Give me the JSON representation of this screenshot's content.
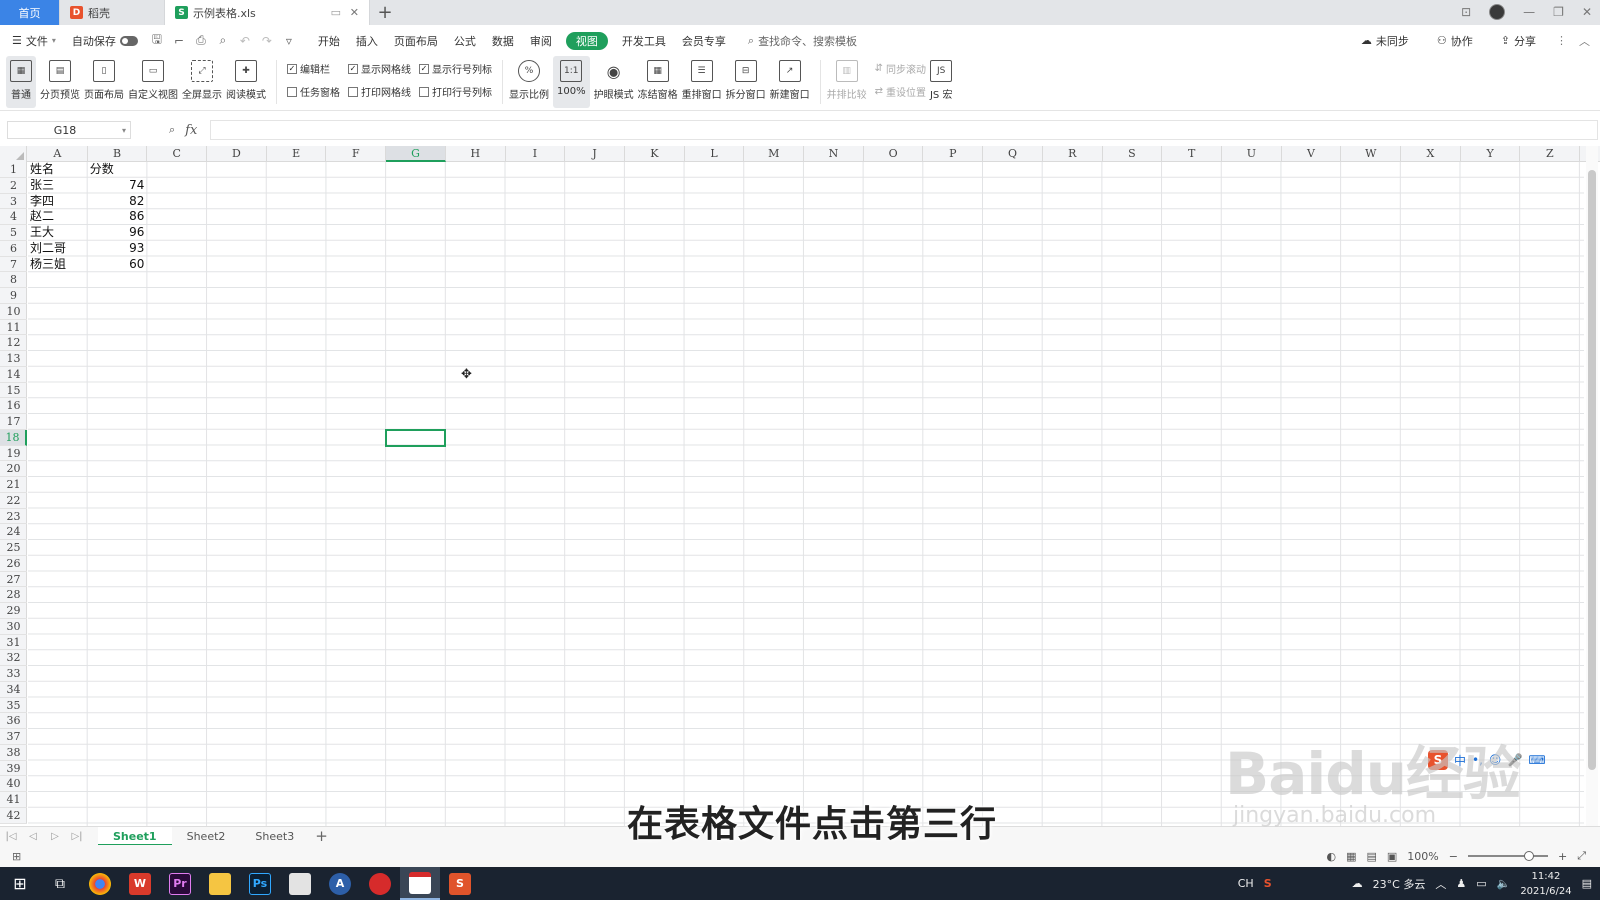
{
  "tabs": [
    {
      "label": "首页",
      "icon": ""
    },
    {
      "label": "稻壳",
      "icon": "D"
    },
    {
      "label": "示例表格.xls",
      "icon": "S"
    }
  ],
  "menu": {
    "file": "文件",
    "autosave": "自动保存",
    "items": [
      "开始",
      "插入",
      "页面布局",
      "公式",
      "数据",
      "审阅",
      "视图",
      "开发工具",
      "会员专享"
    ],
    "search": "查找命令、搜索模板",
    "right": [
      "未同步",
      "协作",
      "分享"
    ]
  },
  "ribbon": {
    "b1": [
      "普通",
      "分页预览",
      "页面布局",
      "自定义视图",
      "全屏显示",
      "阅读模式"
    ],
    "checks_a": [
      "编辑栏",
      "任务窗格"
    ],
    "checks_b": [
      "显示网格线",
      "打印网格线"
    ],
    "checks_c": [
      "显示行号列标",
      "打印行号列标"
    ],
    "b2": [
      "显示比例",
      "100%",
      "护眼模式",
      "冻结窗格",
      "重排窗口",
      "拆分窗口",
      "新建窗口"
    ],
    "b3": [
      "并排比较",
      "同步滚动",
      "重设位置",
      "JS 宏"
    ],
    "icon_1to1": "1:1"
  },
  "formula_bar": {
    "name_box": "G18",
    "fx": "fx",
    "value": ""
  },
  "columns": [
    "A",
    "B",
    "C",
    "D",
    "E",
    "F",
    "G",
    "H",
    "I",
    "J",
    "K",
    "L",
    "M",
    "N",
    "O",
    "P",
    "Q",
    "R",
    "S",
    "T",
    "U",
    "V",
    "W",
    "X",
    "Y",
    "Z"
  ],
  "rows": [
    "1",
    "2",
    "3",
    "4",
    "5",
    "6",
    "7",
    "8",
    "9",
    "10",
    "11",
    "12",
    "13",
    "14",
    "15",
    "16",
    "17",
    "18",
    "19",
    "20",
    "21",
    "22",
    "23",
    "24",
    "25",
    "26",
    "27",
    "28",
    "29",
    "30",
    "31",
    "32",
    "33",
    "34",
    "35",
    "36",
    "37",
    "38",
    "39",
    "40",
    "41",
    "42"
  ],
  "table": {
    "headers": [
      "姓名",
      "分数"
    ],
    "rows": [
      [
        "张三",
        "74"
      ],
      [
        "李四",
        "82"
      ],
      [
        "赵二",
        "86"
      ],
      [
        "王大",
        "96"
      ],
      [
        "刘二哥",
        "93"
      ],
      [
        "杨三姐",
        "60"
      ]
    ]
  },
  "selected": {
    "cell": "G18",
    "column": "G",
    "row": "18"
  },
  "sheets": [
    "Sheet1",
    "Sheet2",
    "Sheet3"
  ],
  "status": {
    "zoom": "100%"
  },
  "taskbar": {
    "apps": [
      "Chrome",
      "WPS",
      "Pr",
      "Explorer",
      "Ps",
      "Office",
      "A",
      "NetEase",
      "Calendar",
      "Sheets"
    ],
    "app_icons": [
      "",
      "W",
      "Pr",
      "",
      "Ps",
      "",
      "A",
      "",
      "",
      "S"
    ],
    "ime": "CH",
    "weather": "23°C 多云",
    "time": "11:42",
    "date": "2021/6/24"
  },
  "subtitle": "在表格文件点击第三行",
  "watermark": {
    "line1": "Baidu经验",
    "line2": "jingyan.baidu.com"
  },
  "ime_bar": [
    "S",
    "中",
    "•,",
    "☺",
    "🎤",
    "⌨"
  ],
  "colors": {
    "accent": "#1f9f5c",
    "tab_home": "#3b84e6",
    "taskbar": "#1a2330"
  }
}
